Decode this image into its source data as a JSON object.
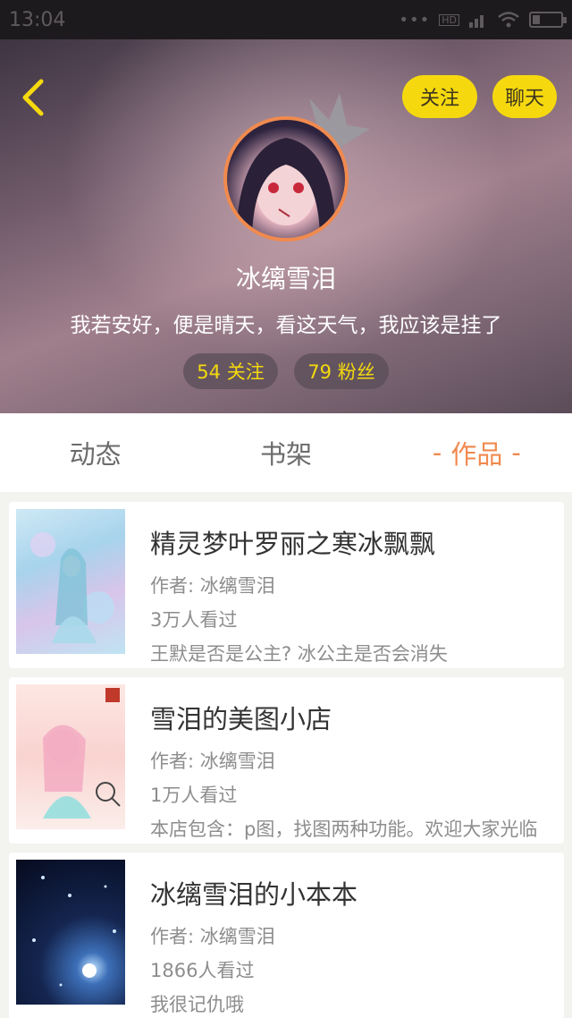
{
  "status_bar": {
    "time": "13:04",
    "network": "HD"
  },
  "header": {
    "follow_label": "关注",
    "chat_label": "聊天",
    "username": "冰缡雪泪",
    "bio": "我若安好，便是晴天，看这天气，我应该是挂了",
    "following_label": "54 关注",
    "fans_label": "79 粉丝"
  },
  "tabs": [
    {
      "label": "动态",
      "active": false
    },
    {
      "label": "书架",
      "active": false
    },
    {
      "label": "作品",
      "active": true
    }
  ],
  "works": [
    {
      "title": "精灵梦叶罗丽之寒冰飘飘",
      "author": "作者: 冰缡雪泪",
      "views": "3万人看过",
      "desc": "王默是否是公主? 冰公主是否会消失"
    },
    {
      "title": "雪泪的美图小店",
      "author": "作者: 冰缡雪泪",
      "views": "1万人看过",
      "desc": "本店包含：p图，找图两种功能。欢迎大家光临"
    },
    {
      "title": "冰缡雪泪的小本本",
      "author": "作者: 冰缡雪泪",
      "views": "1866人看过",
      "desc": "我很记仇哦"
    }
  ],
  "colors": {
    "accent": "#f08a4e",
    "yellow": "#f5d90e"
  }
}
